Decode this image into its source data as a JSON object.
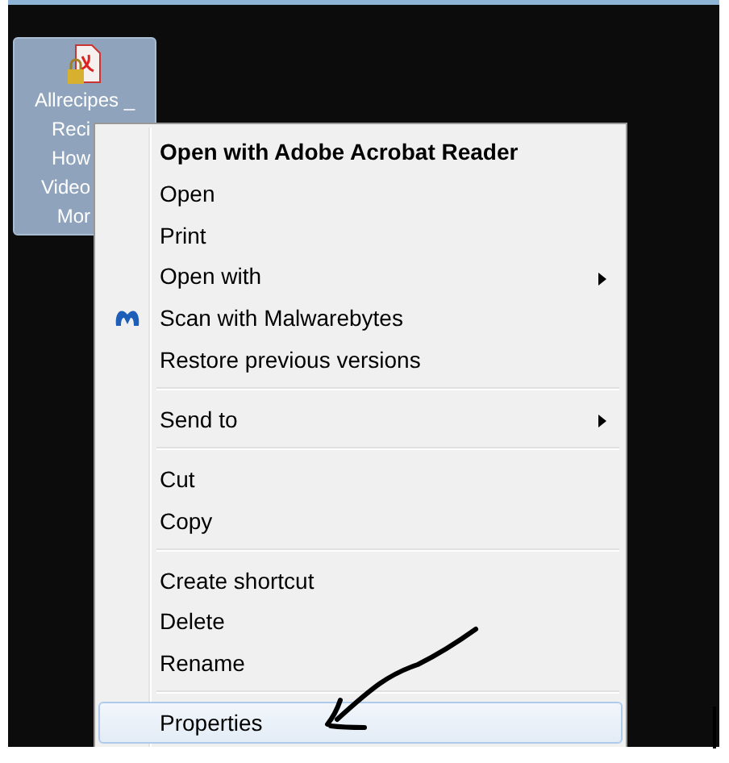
{
  "desktop_icon": {
    "label_lines": [
      "Allrecipes _",
      "Reci",
      "How",
      "Video",
      "Mor"
    ],
    "selected": true
  },
  "context_menu": {
    "items": [
      {
        "kind": "item",
        "label": "Open with Adobe Acrobat Reader",
        "bold": true,
        "submenu": false,
        "icon": false,
        "selected": false
      },
      {
        "kind": "item",
        "label": "Open",
        "bold": false,
        "submenu": false,
        "icon": false,
        "selected": false
      },
      {
        "kind": "item",
        "label": "Print",
        "bold": false,
        "submenu": false,
        "icon": false,
        "selected": false
      },
      {
        "kind": "item",
        "label": "Open with",
        "bold": false,
        "submenu": true,
        "icon": false,
        "selected": false
      },
      {
        "kind": "item",
        "label": "Scan with Malwarebytes",
        "bold": false,
        "submenu": false,
        "icon": true,
        "selected": false
      },
      {
        "kind": "item",
        "label": "Restore previous versions",
        "bold": false,
        "submenu": false,
        "icon": false,
        "selected": false
      },
      {
        "kind": "separator"
      },
      {
        "kind": "item",
        "label": "Send to",
        "bold": false,
        "submenu": true,
        "icon": false,
        "selected": false
      },
      {
        "kind": "separator"
      },
      {
        "kind": "item",
        "label": "Cut",
        "bold": false,
        "submenu": false,
        "icon": false,
        "selected": false
      },
      {
        "kind": "item",
        "label": "Copy",
        "bold": false,
        "submenu": false,
        "icon": false,
        "selected": false
      },
      {
        "kind": "separator"
      },
      {
        "kind": "item",
        "label": "Create shortcut",
        "bold": false,
        "submenu": false,
        "icon": false,
        "selected": false
      },
      {
        "kind": "item",
        "label": "Delete",
        "bold": false,
        "submenu": false,
        "icon": false,
        "selected": false
      },
      {
        "kind": "item",
        "label": "Rename",
        "bold": false,
        "submenu": false,
        "icon": false,
        "selected": false
      },
      {
        "kind": "separator"
      },
      {
        "kind": "item",
        "label": "Properties",
        "bold": false,
        "submenu": false,
        "icon": false,
        "selected": true
      }
    ]
  }
}
